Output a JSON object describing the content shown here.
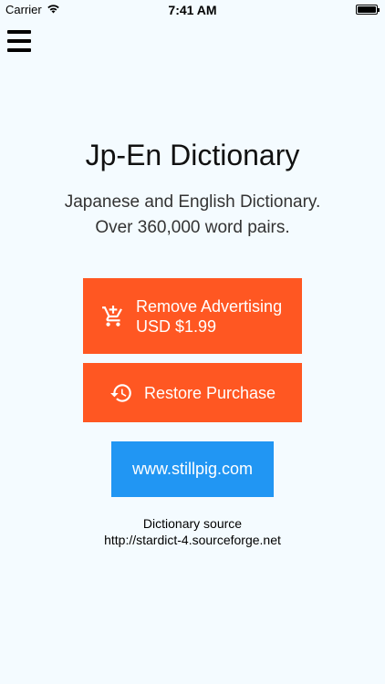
{
  "status_bar": {
    "carrier": "Carrier",
    "time": "7:41 AM"
  },
  "header": {
    "menu_icon": "hamburger-menu-icon"
  },
  "main": {
    "title": "Jp-En Dictionary",
    "subtitle_line1": "Japanese and English Dictionary.",
    "subtitle_line2": "Over 360,000 word pairs.",
    "remove_ads": {
      "label": "Remove Advertising",
      "price": "USD $1.99",
      "icon": "add-to-cart-icon"
    },
    "restore": {
      "label": "Restore Purchase",
      "icon": "history-restore-icon"
    },
    "website": {
      "label": "www.stillpig.com"
    },
    "source": {
      "label": "Dictionary source",
      "url": "http://stardict-4.sourceforge.net"
    }
  },
  "colors": {
    "accent_orange": "#ff5722",
    "accent_blue": "#2196f3",
    "background": "#f4fbff"
  }
}
